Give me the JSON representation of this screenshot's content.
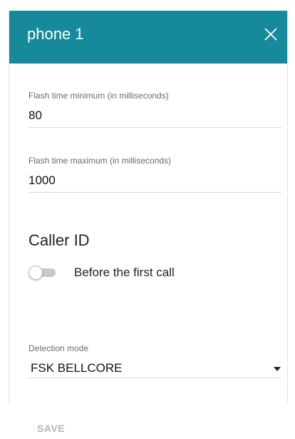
{
  "dialog": {
    "title": "phone 1",
    "close_icon": "close-icon",
    "header_color": "#16899b"
  },
  "fields": {
    "flash_min": {
      "label": "Flash time minimum (in milliseconds)",
      "value": "80"
    },
    "flash_max": {
      "label": "Flash time maximum (in milliseconds)",
      "value": "1000"
    }
  },
  "caller_id": {
    "section_title": "Caller ID",
    "toggle": {
      "label": "Before the first call",
      "state": "off"
    },
    "detection_mode": {
      "label": "Detection mode",
      "selected": "FSK BELLCORE",
      "icon": "dropdown-arrow-icon"
    }
  },
  "actions": {
    "save_label": "SAVE",
    "save_state": "disabled"
  }
}
